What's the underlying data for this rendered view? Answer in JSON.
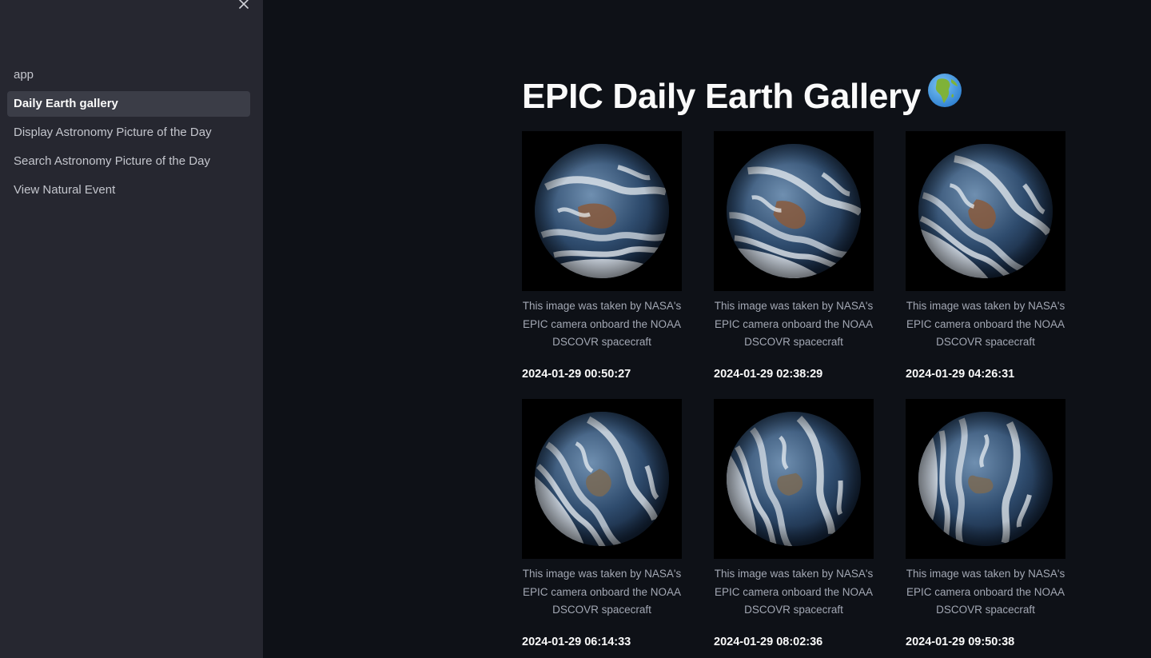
{
  "sidebar": {
    "close_icon": "close-icon",
    "items": [
      {
        "label": "app",
        "active": false
      },
      {
        "label": "Daily Earth gallery",
        "active": true
      },
      {
        "label": "Display Astronomy Picture of the Day",
        "active": false
      },
      {
        "label": "Search Astronomy Picture of the Day",
        "active": false
      },
      {
        "label": "View Natural Event",
        "active": false
      }
    ]
  },
  "main": {
    "title": "EPIC Daily Earth Gallery",
    "title_emoji": "globe-africa-icon",
    "gallery": [
      {
        "caption": "This image was taken by NASA's EPIC camera onboard the NOAA DSCOVR spacecraft",
        "timestamp": "2024-01-29 00:50:27"
      },
      {
        "caption": "This image was taken by NASA's EPIC camera onboard the NOAA DSCOVR spacecraft",
        "timestamp": "2024-01-29 02:38:29"
      },
      {
        "caption": "This image was taken by NASA's EPIC camera onboard the NOAA DSCOVR spacecraft",
        "timestamp": "2024-01-29 04:26:31"
      },
      {
        "caption": "This image was taken by NASA's EPIC camera onboard the NOAA DSCOVR spacecraft",
        "timestamp": "2024-01-29 06:14:33"
      },
      {
        "caption": "This image was taken by NASA's EPIC camera onboard the NOAA DSCOVR spacecraft",
        "timestamp": "2024-01-29 08:02:36"
      },
      {
        "caption": "This image was taken by NASA's EPIC camera onboard the NOAA DSCOVR spacecraft",
        "timestamp": "2024-01-29 09:50:38"
      }
    ]
  },
  "colors": {
    "background": "#0e1117",
    "sidebar": "#262730",
    "active_item": "#3b3d47",
    "caption_text": "#a3a8b4"
  }
}
